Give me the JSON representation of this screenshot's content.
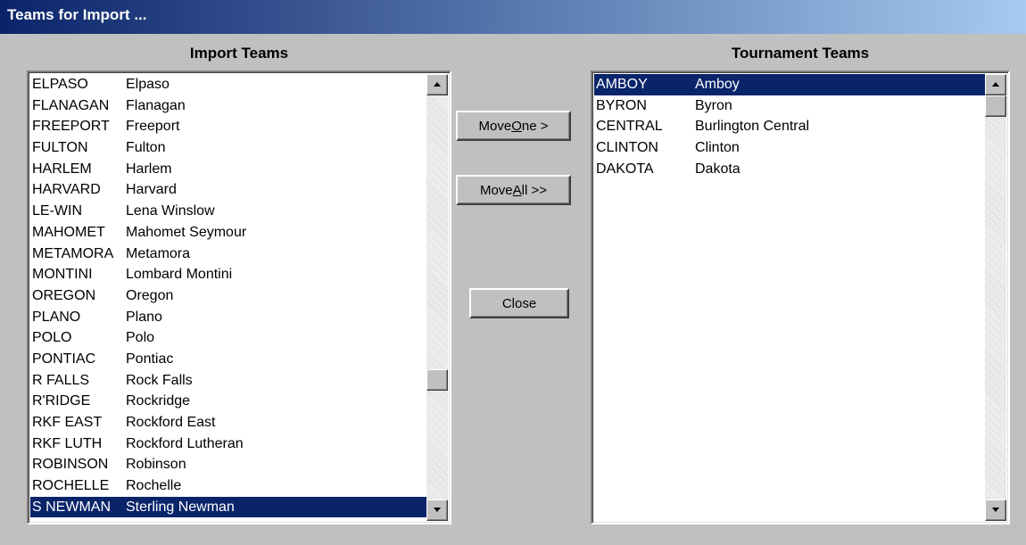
{
  "window": {
    "title": "Teams for Import ..."
  },
  "import_panel": {
    "label": "Import Teams",
    "items": [
      {
        "code": "ELPASO",
        "name": "Elpaso"
      },
      {
        "code": "FLANAGAN",
        "name": "Flanagan"
      },
      {
        "code": "FREEPORT",
        "name": "Freeport"
      },
      {
        "code": "FULTON",
        "name": "Fulton"
      },
      {
        "code": "HARLEM",
        "name": "Harlem"
      },
      {
        "code": "HARVARD",
        "name": "Harvard"
      },
      {
        "code": "LE-WIN",
        "name": "Lena Winslow"
      },
      {
        "code": "MAHOMET",
        "name": "Mahomet Seymour"
      },
      {
        "code": "METAMORA",
        "name": "Metamora"
      },
      {
        "code": "MONTINI",
        "name": "Lombard Montini"
      },
      {
        "code": "OREGON",
        "name": "Oregon"
      },
      {
        "code": "PLANO",
        "name": "Plano"
      },
      {
        "code": "POLO",
        "name": "Polo"
      },
      {
        "code": "PONTIAC",
        "name": "Pontiac"
      },
      {
        "code": "R FALLS",
        "name": "Rock Falls"
      },
      {
        "code": "R'RIDGE",
        "name": "Rockridge"
      },
      {
        "code": "RKF EAST",
        "name": "Rockford East"
      },
      {
        "code": "RKF LUTH",
        "name": "Rockford Lutheran"
      },
      {
        "code": "ROBINSON",
        "name": "Robinson"
      },
      {
        "code": "ROCHELLE",
        "name": "Rochelle"
      },
      {
        "code": "S NEWMAN",
        "name": "Sterling Newman",
        "selected": true
      }
    ]
  },
  "buttons": {
    "move_one": {
      "pre": "Move ",
      "key": "O",
      "post": "ne >"
    },
    "move_all": {
      "pre": "Move ",
      "key": "A",
      "post": "ll >>"
    },
    "close": "Close"
  },
  "tournament_panel": {
    "label": "Tournament Teams",
    "items": [
      {
        "code": "AMBOY",
        "name": "Amboy",
        "selected": true
      },
      {
        "code": "BYRON",
        "name": "Byron"
      },
      {
        "code": "CENTRAL",
        "name": "Burlington Central"
      },
      {
        "code": "CLINTON",
        "name": "Clinton"
      },
      {
        "code": "DAKOTA",
        "name": "Dakota"
      }
    ]
  },
  "colors": {
    "selection": "#0a246a",
    "face": "#c0c0c0"
  }
}
